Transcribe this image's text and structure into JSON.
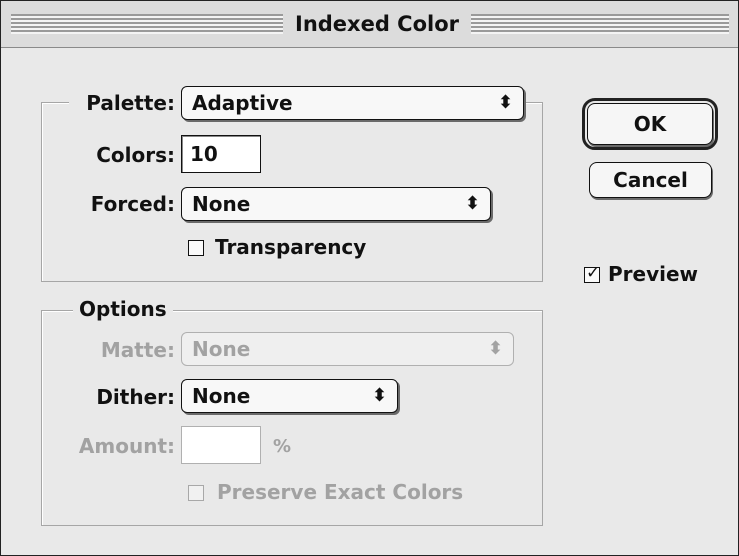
{
  "window": {
    "title": "Indexed Color"
  },
  "palette": {
    "label": "Palette:",
    "value": "Adaptive"
  },
  "colors": {
    "label": "Colors:",
    "value": "10"
  },
  "forced": {
    "label": "Forced:",
    "value": "None"
  },
  "transparency": {
    "label": "Transparency",
    "checked": false
  },
  "options": {
    "legend": "Options",
    "matte": {
      "label": "Matte:",
      "value": "None",
      "enabled": false
    },
    "dither": {
      "label": "Dither:",
      "value": "None"
    },
    "amount": {
      "label": "Amount:",
      "value": "",
      "unit": "%",
      "enabled": false
    },
    "preserve": {
      "label": "Preserve Exact Colors",
      "checked": false,
      "enabled": false
    }
  },
  "buttons": {
    "ok": "OK",
    "cancel": "Cancel"
  },
  "preview": {
    "label": "Preview",
    "checked": true
  },
  "icons": {
    "popup_arrows": "up-down-arrows-icon",
    "checkmark": "checkmark-icon"
  }
}
